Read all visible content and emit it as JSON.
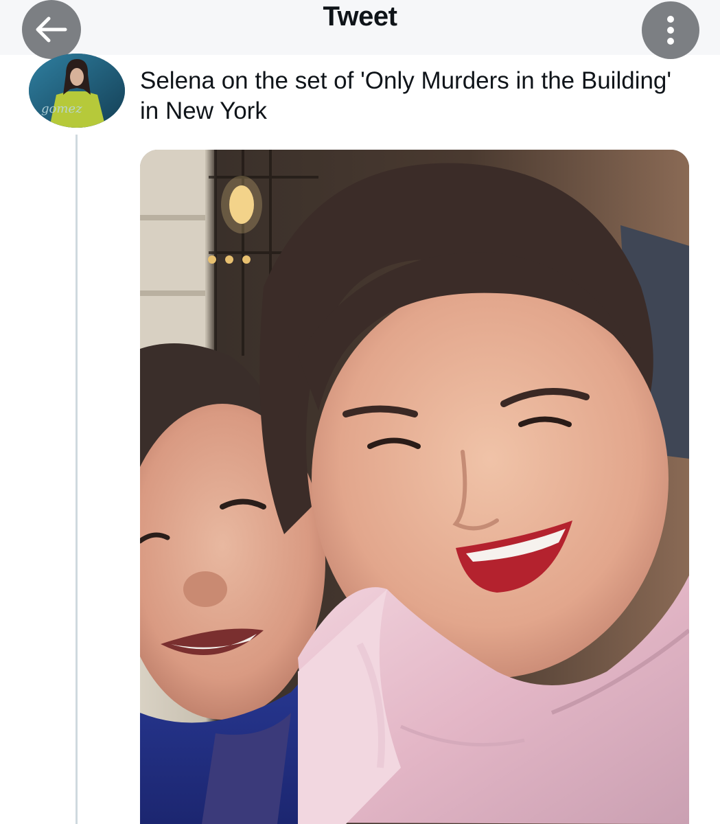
{
  "header": {
    "title": "Tweet",
    "back_icon": "arrow-left-icon",
    "more_icon": "more-vertical-icon"
  },
  "tweet": {
    "text": "Selena on the set of 'Only Murders in the Building' in New York",
    "avatar_logo": "gomez",
    "media_description_icon": "photo"
  },
  "colors": {
    "header_bg": "#f6f7f9",
    "button_bg": "#7c7f83",
    "text": "#0f1419",
    "thread_line": "#cfd9de"
  }
}
